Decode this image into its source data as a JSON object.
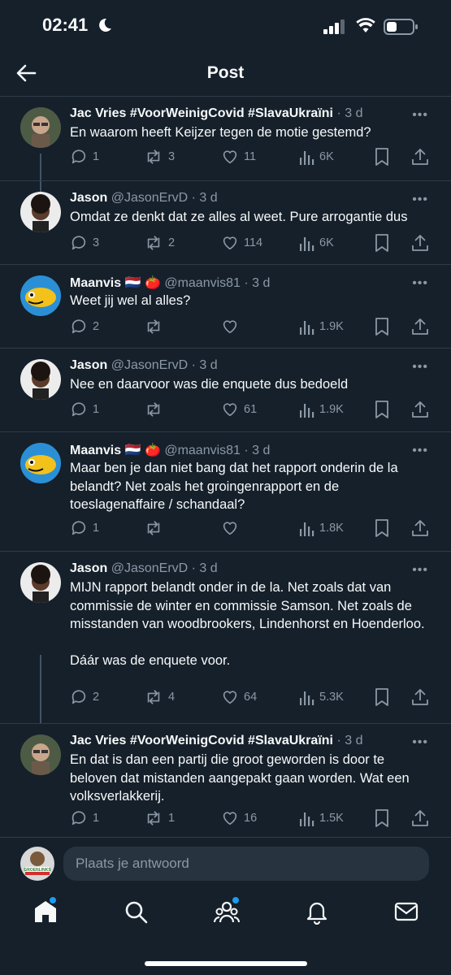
{
  "status_bar": {
    "time": "02:41"
  },
  "header": {
    "title": "Post"
  },
  "tweets": [
    {
      "name": "Jac Vries #VoorWeinigCovid #SlavaUkraïni",
      "meta": "· 3 d",
      "text": "En waarom heeft Keijzer tegen de motie gestemd?",
      "replies": "1",
      "reposts": "3",
      "likes": "11",
      "views": "6K"
    },
    {
      "name": "Jason",
      "meta": "@JasonErvD · 3 d",
      "text": "Omdat ze denkt dat ze alles al weet. Pure arrogantie dus",
      "replies": "3",
      "reposts": "2",
      "likes": "114",
      "views": "6K"
    },
    {
      "name": "Maanvis 🇳🇱 🍅",
      "meta": "@maanvis81 · 3 d",
      "text": "Weet jij wel al alles?",
      "replies": "2",
      "reposts": "",
      "likes": "",
      "views": "1.9K"
    },
    {
      "name": "Jason",
      "meta": "@JasonErvD · 3 d",
      "text": "Nee en daarvoor was die enquete dus bedoeld",
      "replies": "1",
      "reposts": "",
      "likes": "61",
      "views": "1.9K"
    },
    {
      "name": "Maanvis 🇳🇱 🍅",
      "meta": "@maanvis81 · 3 d",
      "text": "Maar ben je dan niet bang dat het rapport onderin de la belandt? Net zoals het groingenrapport en de toeslagenaffaire / schandaal?",
      "replies": "1",
      "reposts": "",
      "likes": "",
      "views": "1.8K"
    },
    {
      "name": "Jason",
      "meta": "@JasonErvD · 3 d",
      "text": "MIJN rapport belandt onder in de la. Net zoals dat van commissie de winter en commissie Samson. Net zoals de misstanden van woodbrookers, Lindenhorst en Hoenderloo.\n\nDáár was de enquete voor.",
      "replies": "2",
      "reposts": "4",
      "likes": "64",
      "views": "5.3K"
    },
    {
      "name": "Jac Vries #VoorWeinigCovid #SlavaUkraïni",
      "meta": "· 3 d",
      "text": "En dat is dan een partij die groot geworden is door te beloven dat mistanden aangepakt gaan worden. Wat een volksverlakkerij.",
      "replies": "1",
      "reposts": "1",
      "likes": "16",
      "views": "1.5K"
    }
  ],
  "reply_bar": {
    "placeholder": "Plaats je antwoord",
    "avatar_text": "GROENLINKS"
  },
  "tabbar": {
    "items": [
      "home-icon",
      "search-icon",
      "communities-icon",
      "notifications-icon",
      "messages-icon"
    ]
  },
  "colors": {
    "background": "#15202b",
    "accent": "#1d9bf0",
    "muted": "#8b98a5"
  }
}
